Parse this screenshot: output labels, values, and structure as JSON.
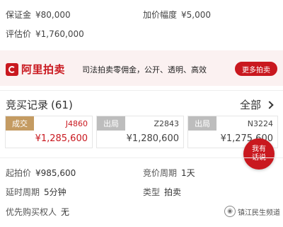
{
  "summary": {
    "deposit_label": "保证金",
    "deposit_value": "¥80,000",
    "increment_label": "加价幅度",
    "increment_value": "¥5,000",
    "appraisal_label": "评估价",
    "appraisal_value": "¥1,760,000"
  },
  "banner": {
    "logo_text": "阿里拍卖",
    "slogan": "司法拍卖零佣金，公开、透明、高效",
    "more_button": "更多拍卖"
  },
  "records": {
    "title": "竞买记录",
    "count": "(61)",
    "all_label": "全部",
    "bids": [
      {
        "status": "成交",
        "bidder": "J4860",
        "price": "¥1,285,600"
      },
      {
        "status": "出局",
        "bidder": "Z2843",
        "price": "¥1,280,600"
      },
      {
        "status": "出局",
        "bidder": "N3224",
        "price": "¥1,275,600"
      }
    ]
  },
  "chat": {
    "label_line1": "我有",
    "label_line2": "话说"
  },
  "details": {
    "start_price_label": "起拍价",
    "start_price_value": "¥985,600",
    "bid_cycle_label": "竞价周期",
    "bid_cycle_value": "1天",
    "extension_label": "延时周期",
    "extension_value": "5分钟",
    "type_label": "类型",
    "type_value": "拍卖",
    "priority_label": "优先购买权人",
    "priority_value": "无"
  },
  "watermark": {
    "text": "镇江民生频道"
  },
  "colors": {
    "brand_red": "#c9181f",
    "won_tag": "#c49b62",
    "out_tag": "#bdbdbd",
    "banner_bg": "#fbf1f1"
  }
}
